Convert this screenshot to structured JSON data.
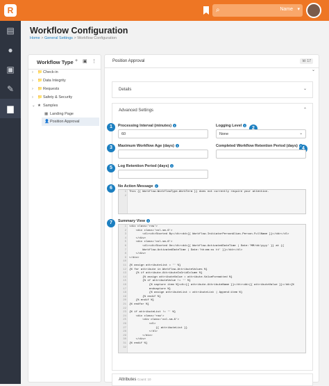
{
  "header": {
    "logo_letter": "R",
    "user_name": "Name",
    "chevron": "▾",
    "search_icon": "⌕"
  },
  "sidebar": {
    "icons": [
      "file-icon",
      "person-icon",
      "money-icon",
      "wrench-icon",
      "briefcase-icon"
    ]
  },
  "page": {
    "title": "Workflow Configuration",
    "breadcrumb": [
      "Home",
      "General Settings",
      "Workflow Configuration"
    ]
  },
  "left_panel": {
    "title": "Workflow Type",
    "actions": [
      "+",
      "▣",
      "⋮"
    ],
    "tree": [
      {
        "label": "Check-in",
        "caret": "›",
        "icon": "📁"
      },
      {
        "label": "Data Integrity",
        "caret": "›",
        "icon": "📁"
      },
      {
        "label": "Requests",
        "caret": "›",
        "icon": "📁"
      },
      {
        "label": "Safety & Security",
        "caret": "›",
        "icon": "📁"
      },
      {
        "label": "Samples",
        "caret": "⌄",
        "icon": "★"
      },
      {
        "label": "Landing Page",
        "caret": "",
        "icon": "▦"
      },
      {
        "label": "Position Approval",
        "caret": "",
        "icon": "👤"
      }
    ]
  },
  "right_panel": {
    "title": "Position Approval",
    "id_badge": "Id: 17",
    "details_label": "Details",
    "advanced_label": "Advanced Settings",
    "attributes_label": "Attributes",
    "attributes_count": "Count: 10",
    "fields": {
      "processing_interval": {
        "label": "Processing Interval (minutes)",
        "value": "60",
        "num": "1"
      },
      "logging_level": {
        "label": "Logging Level",
        "value": "None",
        "num": "2"
      },
      "max_age": {
        "label": "Maximum Workflow Age (days)",
        "value": "",
        "num": "3"
      },
      "completed_retention": {
        "label": "Completed Workflow Retention Period (days)",
        "value": "",
        "num": "4"
      },
      "log_retention": {
        "label": "Log Retention Period (days)",
        "value": "",
        "num": "5"
      },
      "no_action": {
        "label": "No Action Message",
        "num": "6",
        "lines": [
          "This {{ Workflow.WorkflowType.WorkTerm }} does not currently require your attention."
        ]
      },
      "summary": {
        "label": "Summary View",
        "num": "7",
        "lines": [
          "<div class='row'>",
          "    <div class='col-sm-6'>",
          "        <dl><dt>Started By</dt><dd>{{ Workflow.InitiatorPersonAlias.Person.FullName }}</dd></dl>",
          "    </div>",
          "    <div class='col-sm-6'>",
          "        <dl><dt>Started On</dt><dd>{{ Workflow.ActivatedDateTime | Date:'MM/dd/yyyy' }} at {{",
          "        Workflow.ActivatedDateTime | Date:'hh:mm:ss tt' }}</dd></dl>",
          "    </div>",
          "</div>",
          "",
          "{% assign attributeList = '' %}",
          "{% for attribute in Workflow.AttributeValues %}",
          "    {% if attribute.AttributeIsGridColumn %}",
          "        {% assign attributeValue = attribute.ValueFormatted %}",
          "        {% if attributeValue != '' %}",
          "            {% capture item %}<dt>{{ attribute.AttributeName }}</dt><dd>{{ attributeValue }}</dd>{%",
          "            endcapture %}",
          "            {% assign attributeList = attributeList | Append:item %}",
          "        {% endif %}",
          "    {% endif %}",
          "{% endfor %}",
          "",
          "{% if attributeList != '' %}",
          "    <div class='row'>",
          "        <div class='col-sm-6'>",
          "            <dl>",
          "                {{ attributeList }}",
          "            </dl>",
          "        </div>",
          "    </div>",
          "{% endif %}",
          ""
        ]
      }
    }
  }
}
